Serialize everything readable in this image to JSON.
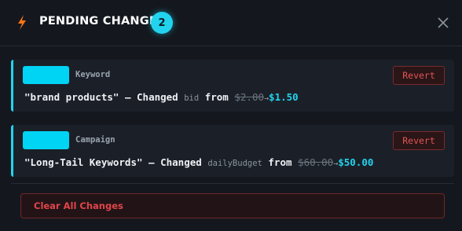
{
  "header": {
    "title": "PENDING CHANGES",
    "count": "2",
    "icon": "lightning-bolt-icon",
    "close_icon": "close-icon"
  },
  "changes": [
    {
      "type": "Keyword",
      "name": "\"brand products\"",
      "separator": "—",
      "action": "Changed",
      "field": "bid",
      "from_label": "from",
      "old_value": "$2.00",
      "arrow": "→",
      "new_value": "$1.50",
      "revert_label": "Revert"
    },
    {
      "type": "Campaign",
      "name": "\"Long-Tail Keywords\"",
      "separator": "—",
      "action": "Changed",
      "field": "dailyBudget",
      "from_label": "from",
      "old_value": "$60.00",
      "arrow": "→",
      "new_value": "$50.00",
      "revert_label": "Revert"
    }
  ],
  "footer": {
    "clear_label": "Clear All Changes"
  },
  "colors": {
    "accent": "#22d3ee",
    "danger": "#e0454a",
    "bolt": "#f97316",
    "background": "#14181e"
  }
}
